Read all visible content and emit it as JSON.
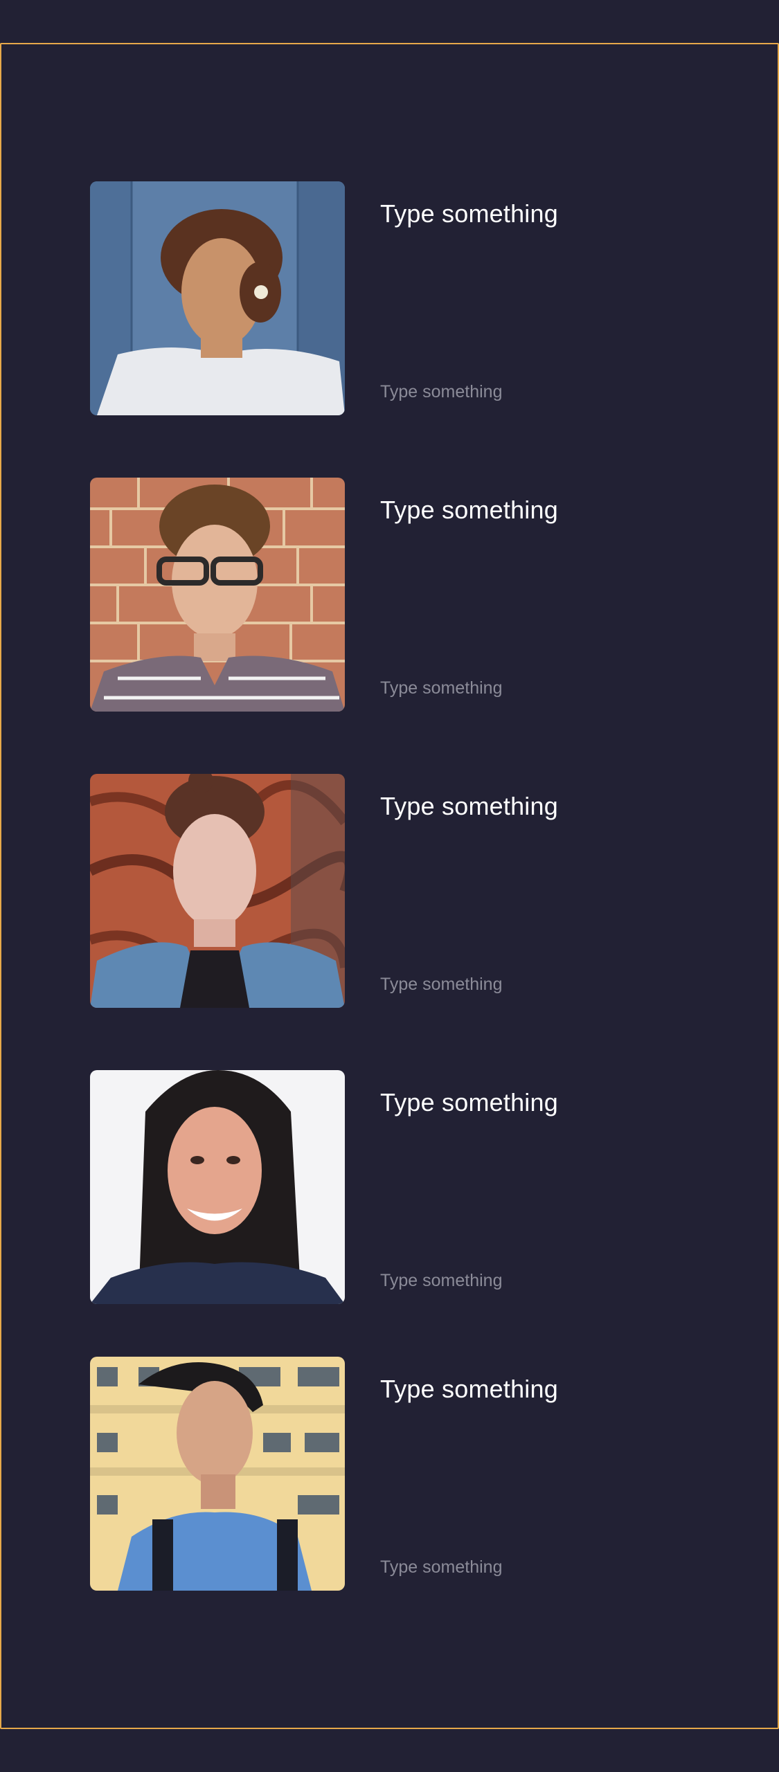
{
  "cards": [
    {
      "title": "Type something",
      "subtitle": "Type something",
      "image": "woman-portrait-blue-wood-wall"
    },
    {
      "title": "Type something",
      "subtitle": "Type something",
      "image": "man-portrait-glasses-brick-wall"
    },
    {
      "title": "Type something",
      "subtitle": "Type something",
      "image": "woman-portrait-denim-jacket-red-wall"
    },
    {
      "title": "Type something",
      "subtitle": "Type something",
      "image": "woman-portrait-smiling-white-wall"
    },
    {
      "title": "Type something",
      "subtitle": "Type something",
      "image": "man-portrait-blue-shirt-building"
    }
  ],
  "colors": {
    "background": "#222134",
    "frame_border": "#e7a94a",
    "title_text": "#ffffff",
    "subtitle_text": "#8b8b98"
  }
}
